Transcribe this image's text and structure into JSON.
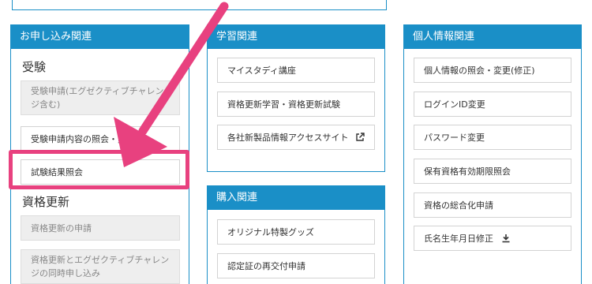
{
  "colors": {
    "panel_blue": "#1a8fc7",
    "highlight_pink": "#e8417f"
  },
  "apply": {
    "header": "お申し込み関連",
    "exam_title": "受験",
    "exam_items": [
      {
        "label": "受験申請(エグゼクティブチャレンジ含む)",
        "disabled": true
      },
      {
        "label": "受験申請内容の照会・変更",
        "disabled": false
      },
      {
        "label": "試験結果照会",
        "disabled": false
      }
    ],
    "renew_title": "資格更新",
    "renew_items": [
      {
        "label": "資格更新の申請",
        "disabled": true
      },
      {
        "label": "資格更新とエグゼクティブチャレンジの同時申し込み",
        "disabled": true
      }
    ]
  },
  "study": {
    "header": "学習関連",
    "items": [
      {
        "label": "マイスタディ講座",
        "icon": null
      },
      {
        "label": "資格更新学習・資格更新試験",
        "icon": null
      },
      {
        "label": "各社新製品情報アクセスサイト",
        "icon": "external-link-icon"
      }
    ]
  },
  "buy": {
    "header": "購入関連",
    "items": [
      {
        "label": "オリジナル特製グッズ"
      },
      {
        "label": "認定証の再交付申請"
      }
    ]
  },
  "personal": {
    "header": "個人情報関連",
    "items": [
      {
        "label": "個人情報の照会・変更(修正)",
        "icon": null
      },
      {
        "label": "ログインID変更",
        "icon": null
      },
      {
        "label": "パスワード変更",
        "icon": null
      },
      {
        "label": "保有資格有効期限照会",
        "icon": null
      },
      {
        "label": "資格の総合化申請",
        "icon": null
      },
      {
        "label": "氏名生年月日修正",
        "icon": "download-icon"
      }
    ]
  }
}
